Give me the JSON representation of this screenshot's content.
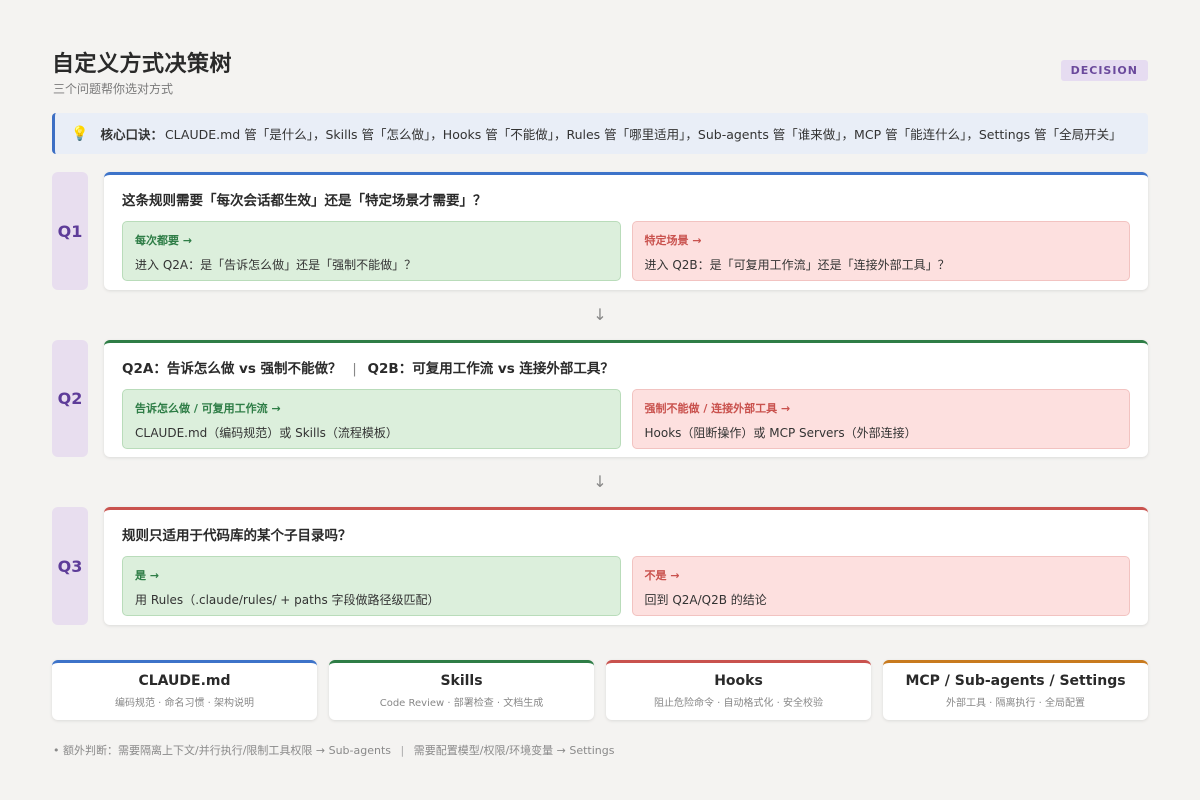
{
  "header": {
    "title": "自定义方式决策树",
    "subtitle": "三个问题帮你选对方式",
    "tag": "DECISION"
  },
  "tip": {
    "icon": "lightbulb-icon",
    "label": "核心口诀：",
    "text": "CLAUDE.md 管「是什么」，Skills 管「怎么做」，Hooks 管「不能做」，Rules 管「哪里适用」，Sub-agents 管「谁来做」，MCP 管「能连什么」，Settings 管「全局开关」"
  },
  "questions": [
    {
      "label": "Q1",
      "title": "这条规则需要「每次会话都生效」还是「特定场景才需要」？",
      "title_b": "",
      "yes": {
        "head": "每次都要 →",
        "body": "进入 Q2A：是「告诉怎么做」还是「强制不能做」？"
      },
      "no": {
        "head": "特定场景 →",
        "body": "进入 Q2B：是「可复用工作流」还是「连接外部工具」？"
      }
    },
    {
      "label": "Q2",
      "title": "Q2A：告诉怎么做 vs 强制不能做？",
      "title_sep": "|",
      "title_b": "Q2B：可复用工作流 vs 连接外部工具？",
      "yes": {
        "head": "告诉怎么做 / 可复用工作流 →",
        "body": "CLAUDE.md（编码规范）或 Skills（流程模板）"
      },
      "no": {
        "head": "强制不能做 / 连接外部工具 →",
        "body": "Hooks（阻断操作）或 MCP Servers（外部连接）"
      }
    },
    {
      "label": "Q3",
      "title": "规则只适用于代码库的某个子目录吗？",
      "title_b": "",
      "yes": {
        "head": "是 →",
        "body": "用 Rules（.claude/rules/ + paths 字段做路径级匹配）"
      },
      "no": {
        "head": "不是 →",
        "body": "回到 Q2A/Q2B 的结论"
      }
    }
  ],
  "arrows": [
    "↓",
    "↓"
  ],
  "tools": [
    {
      "name": "CLAUDE.md",
      "desc": "编码规范 · 命名习惯 · 架构说明",
      "color": "#3d73c9"
    },
    {
      "name": "Skills",
      "desc": "Code Review · 部署检查 · 文档生成",
      "color": "#2e7d46"
    },
    {
      "name": "Hooks",
      "desc": "阻止危险命令 · 自动格式化 · 安全校验",
      "color": "#c9524e"
    },
    {
      "name": "MCP / Sub-agents / Settings",
      "desc": "外部工具 · 隔离执行 · 全局配置",
      "color": "#c87a1e"
    }
  ],
  "footnote": {
    "part1": "• 额外判断：需要隔离上下文/并行执行/限制工具权限 → Sub-agents",
    "sep": "|",
    "part2": "需要配置模型/权限/环境变量 → Settings"
  },
  "colors": {
    "accent_blue": "#3d73c9",
    "accent_green": "#2e7d46",
    "accent_red": "#c9524e",
    "accent_orange": "#c87a1e",
    "q_label_purple": "#5e3d99"
  }
}
